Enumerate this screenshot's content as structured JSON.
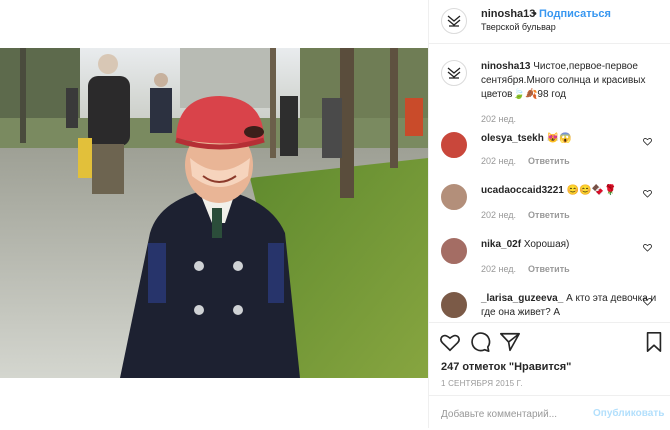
{
  "post": {
    "username": "ninosha13",
    "dot": "•",
    "follow_label": "Подписаться",
    "location": "Тверской бульвар",
    "caption_user": "ninosha13",
    "caption_text": "Чистое,первое-первое сентября.Много солнца и красивых цветов🍃🍂98 год",
    "caption_time": "202 нед."
  },
  "comments": [
    {
      "user": "olesya_tsekh",
      "text": "😻😱",
      "time": "202 нед.",
      "reply": "Ответить",
      "avatar_color": "#c9473b"
    },
    {
      "user": "ucadaoccaid3221",
      "text": "😊😊🍫🌹",
      "time": "202 нед.",
      "reply": "Ответить",
      "avatar_color": "#b38f7a"
    },
    {
      "user": "nika_02f",
      "text": "Хорошая)",
      "time": "202 нед.",
      "reply": "Ответить",
      "avatar_color": "#a46d64"
    },
    {
      "user": "_larisa_guzeeva_",
      "text": "А кто эта девочка и где она живет? А",
      "time": "",
      "reply": "",
      "avatar_color": "#7b5a47"
    }
  ],
  "actions": {
    "likes": "247 отметок \"Нравится\"",
    "date": "1 СЕНТЯБРЯ 2015 Г.",
    "comment_placeholder": "Добавьте комментарий...",
    "publish_label": "Опубликовать"
  },
  "icons": {
    "like": "heart-icon",
    "comment": "comment-bubble-icon",
    "share": "paper-plane-icon",
    "save": "bookmark-icon"
  },
  "colors": {
    "accent": "#3897f0",
    "publish_disabled": "#b2dffc",
    "muted": "#999999"
  }
}
